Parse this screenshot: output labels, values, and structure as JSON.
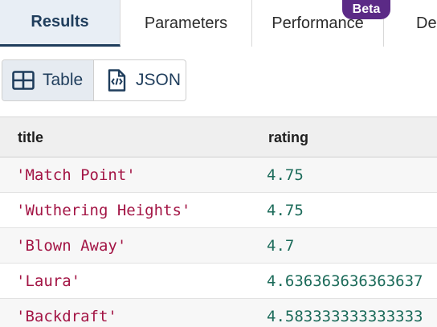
{
  "tabs": [
    {
      "label": "Results"
    },
    {
      "label": "Parameters"
    },
    {
      "label": "Performance"
    },
    {
      "label": "De"
    }
  ],
  "beta_badge": "Beta",
  "view_toggle": {
    "table_label": "Table",
    "json_label": "JSON",
    "selected": "Table"
  },
  "table": {
    "columns": [
      "title",
      "rating"
    ],
    "rows": [
      {
        "title": "'Match Point'",
        "rating": "4.75"
      },
      {
        "title": "'Wuthering Heights'",
        "rating": "4.75"
      },
      {
        "title": "'Blown Away'",
        "rating": "4.7"
      },
      {
        "title": "'Laura'",
        "rating": "4.636363636363637"
      },
      {
        "title": "'Backdraft'",
        "rating": "4.583333333333333"
      }
    ]
  },
  "colors": {
    "accent": "#1f3d5c",
    "badge": "#5b2a86",
    "string_value": "#a31545",
    "number_value": "#1c6b5a"
  },
  "icons": {
    "table": "table-grid-icon",
    "json": "json-file-icon"
  }
}
